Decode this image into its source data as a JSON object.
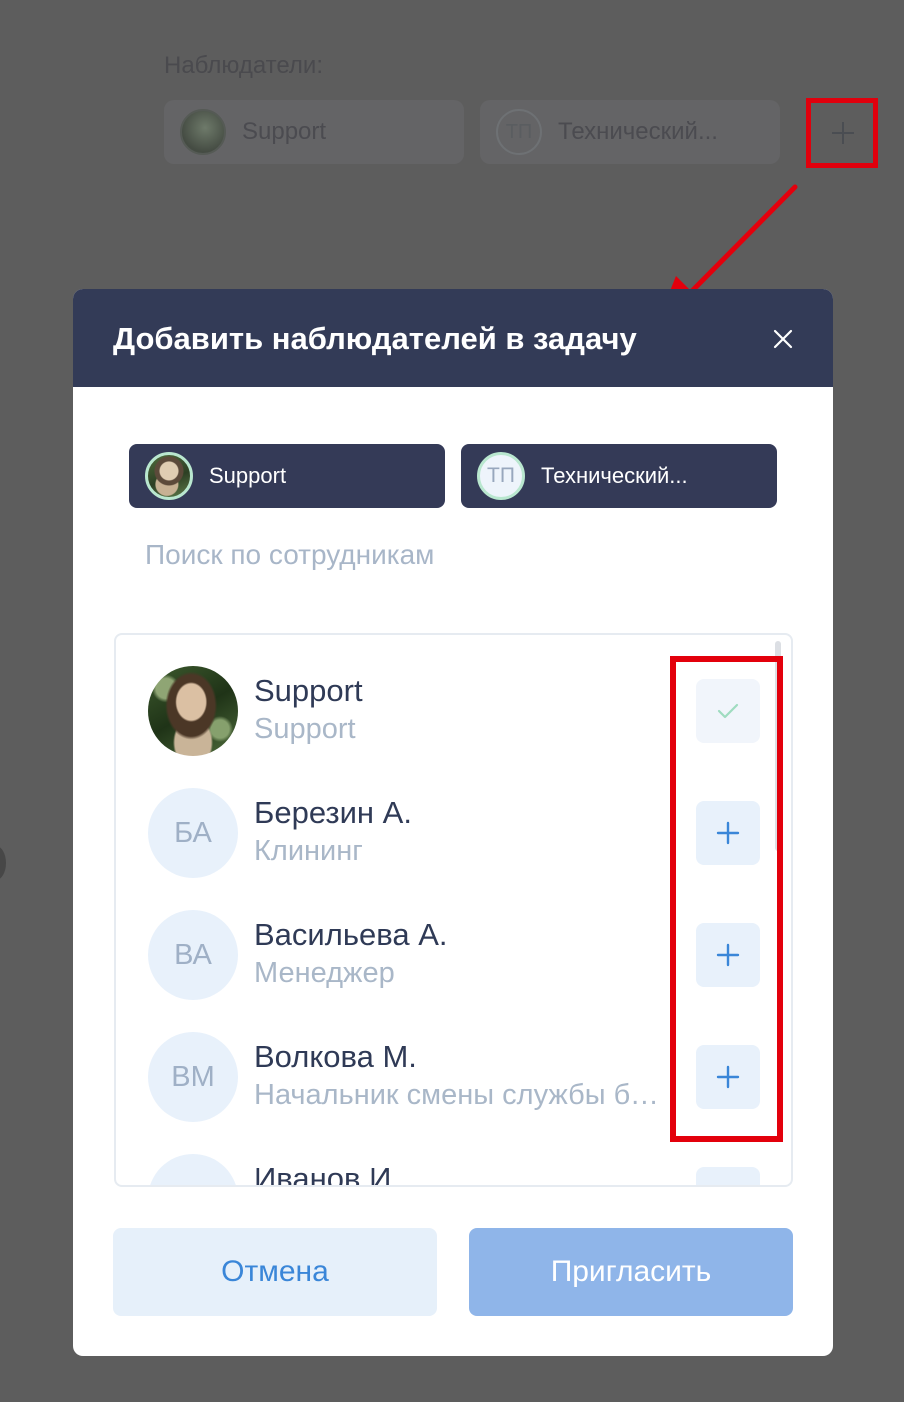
{
  "background": {
    "section_title": "Наблюдатели:",
    "chips": [
      {
        "label": "Support",
        "avatar": "photo"
      },
      {
        "label": "Технический...",
        "avatar_initials": "ТП"
      }
    ],
    "add_icon": "plus-icon"
  },
  "modal": {
    "title": "Добавить наблюдателей в задачу",
    "close_icon": "close-icon",
    "selected_chips": [
      {
        "label": "Support",
        "avatar": "photo"
      },
      {
        "label": "Технический...",
        "avatar_initials": "ТП"
      }
    ],
    "search": {
      "placeholder": "Поиск по сотрудникам",
      "value": ""
    },
    "employees": [
      {
        "name": "Support",
        "role": "Support",
        "avatar": "photo",
        "state": "selected",
        "action_icon": "check-icon"
      },
      {
        "name": "Березин А.",
        "role": "Клининг",
        "initials": "БА",
        "state": "available",
        "action_icon": "plus-icon"
      },
      {
        "name": "Васильева А.",
        "role": "Менеджер",
        "initials": "ВА",
        "state": "available",
        "action_icon": "plus-icon"
      },
      {
        "name": "Волкова М.",
        "role": "Начальник смены службы безопасности",
        "initials": "ВМ",
        "state": "available",
        "action_icon": "plus-icon"
      },
      {
        "name": "Иванов И.",
        "role": "",
        "initials": "",
        "state": "available",
        "action_icon": "plus-icon"
      }
    ],
    "cancel_label": "Отмена",
    "invite_label": "Пригласить"
  },
  "colors": {
    "header": "#333b57",
    "chip": "#343a57",
    "accent": "#3a86d8",
    "invite_disabled": "#8fb5e9",
    "highlight": "#e3000c"
  }
}
